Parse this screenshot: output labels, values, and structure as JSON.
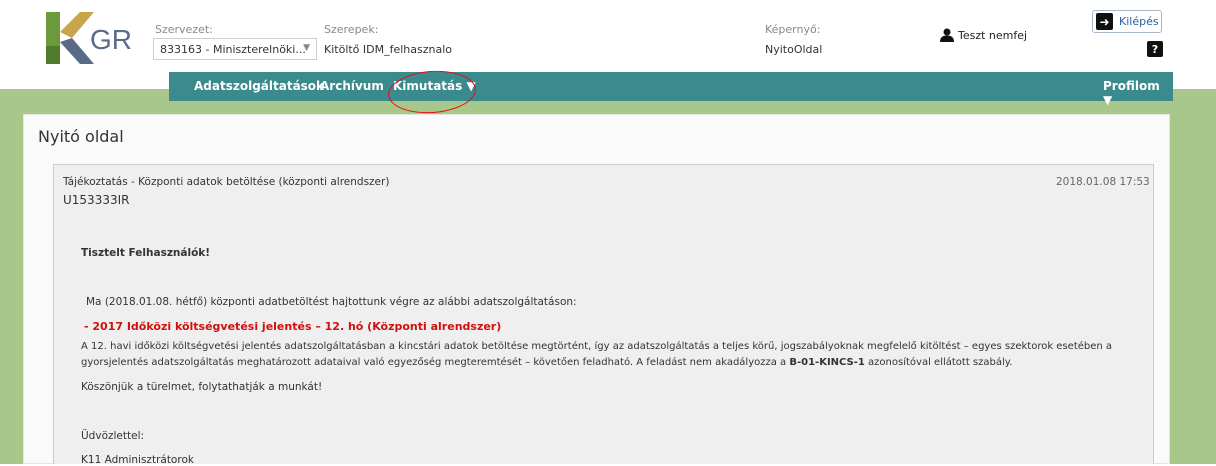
{
  "header": {
    "logo_text": "GR",
    "org_label": "Szervezet:",
    "org_value": "833163 - Miniszterelnöki...",
    "roles_label": "Szerepek:",
    "roles_value": "Kitöltő IDM_felhasznalo",
    "screen_label": "Képernyő:",
    "screen_value": "NyitoOldal",
    "user_name": "Teszt nemfej",
    "logout_label": "Kilépés",
    "help_label": "?"
  },
  "nav": {
    "items": [
      "Adatszolgáltatások",
      "Archívum",
      "Kimutatás ▼"
    ],
    "profile": "Profilom ▼"
  },
  "page": {
    "title": "Nyitó oldal"
  },
  "message": {
    "heading": "Tájékoztatás - Központi adatok betöltése (központi alrendszer)",
    "date": "2018.01.08 17:53",
    "sender": "U153333IR",
    "greeting": "Tisztelt Felhasználók!",
    "intro": "Ma (2018.01.08. hétfő) központi adatbetöltést hajtottunk végre az alábbi adatszolgáltatáson:",
    "highlight": "- 2017 Időközi költségvetési jelentés – 12. hó (Központi alrendszer)",
    "body_line1": "A 12. havi időközi költségvetési jelentés adatszolgáltatásban a kincstári adatok betöltése megtörtént, így az adatszolgáltatás a teljes körű, jogszabályoknak megfelelő kitöltést – egyes szektorok esetében a",
    "body_line2_a": "gyorsjelentés adatszolgáltatás meghatározott adataival való egyezőség megteremtését – követően feladható. A feladást nem akadályozza a ",
    "body_line2_b": "B-01-KINCS-1",
    "body_line2_c": " azonosítóval ellátott szabály.",
    "thanks": "Köszönjük a türelmet, folytathatják a munkát!",
    "closing": "Üdvözlettel:",
    "signature": "K11 Adminisztrátorok"
  },
  "colors": {
    "nav_bg": "#3b8a8d",
    "page_bg": "#a7c78b",
    "logo_green": "#6a9a3a",
    "logo_gold": "#c8a44a",
    "highlight_red": "#d10f0f"
  }
}
